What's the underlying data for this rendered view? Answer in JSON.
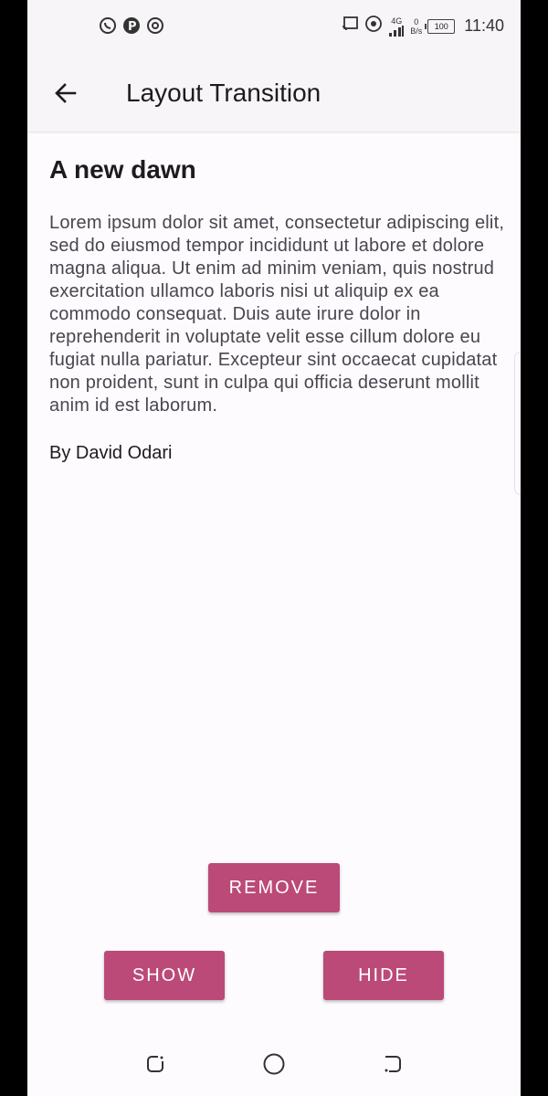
{
  "status_bar": {
    "time": "11:40",
    "network": "4G",
    "speed_value": "0",
    "speed_unit": "B/s",
    "battery": "100",
    "left_icons": [
      "whatsapp-icon",
      "p-icon",
      "hotspot-icon"
    ],
    "right_icons": [
      "cast-icon",
      "wifi-hotspot-icon",
      "signal-icon",
      "battery-icon"
    ]
  },
  "app_bar": {
    "title": "Layout Transition",
    "back_icon": "arrow-back-icon"
  },
  "article": {
    "headline": "A new dawn",
    "body": "Lorem ipsum dolor sit amet, consectetur adipiscing elit, sed do eiusmod tempor incididunt ut labore et dolore magna aliqua. Ut enim ad minim veniam, quis nostrud exercitation ullamco laboris nisi ut aliquip ex ea commodo consequat. Duis aute irure dolor in reprehenderit in voluptate velit esse cillum dolore eu fugiat nulla pariatur. Excepteur sint occaecat cupidatat non proident, sunt in culpa qui officia deserunt mollit anim id est laborum.",
    "author": "By David Odari"
  },
  "actions": {
    "remove_label": "REMOVE",
    "show_label": "SHOW",
    "hide_label": "HIDE"
  },
  "nav_bar": {
    "icons": [
      "recents-icon",
      "home-icon",
      "back-icon"
    ]
  },
  "colors": {
    "accent": "#bb4a78",
    "surface": "#fdfbfd",
    "app_bar": "#f7f5f8"
  }
}
